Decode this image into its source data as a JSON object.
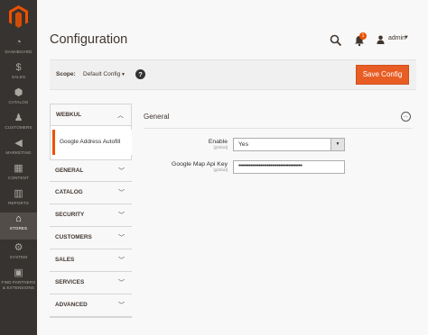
{
  "sidebar": {
    "items": [
      {
        "label": "Dashboard",
        "icon": "speedometer-icon"
      },
      {
        "label": "Sales",
        "icon": "dollar-icon"
      },
      {
        "label": "Catalog",
        "icon": "cube-icon"
      },
      {
        "label": "Customers",
        "icon": "person-icon"
      },
      {
        "label": "Marketing",
        "icon": "megaphone-icon"
      },
      {
        "label": "Content",
        "icon": "layout-icon"
      },
      {
        "label": "Reports",
        "icon": "bar-chart-icon"
      },
      {
        "label": "Stores",
        "icon": "storefront-icon"
      },
      {
        "label": "System",
        "icon": "gear-icon"
      },
      {
        "label": "Find Partners",
        "label2": "& Extensions",
        "icon": "partners-icon"
      }
    ],
    "active": "Stores"
  },
  "header": {
    "title": "Configuration",
    "notification_count": "1",
    "username": "admin"
  },
  "scope": {
    "label": "Scope:",
    "value": "Default Config",
    "help": "?",
    "save_label": "Save Config"
  },
  "config_nav": {
    "sections": [
      "WEBKUL",
      "GENERAL",
      "CATALOG",
      "SECURITY",
      "CUSTOMERS",
      "SALES",
      "SERVICES",
      "ADVANCED"
    ],
    "active_sub_item": "Google Address Autofill"
  },
  "content": {
    "group_title": "General",
    "fields": [
      {
        "label": "Enable",
        "scope": "[global]",
        "value": "Yes"
      },
      {
        "label": "Google Map Api Key",
        "scope": "[global]",
        "value": "••••••••••••••••••••••••••••••••••••••"
      }
    ]
  },
  "colors": {
    "sidebar_bg": "#373330",
    "accent": "#eb5202",
    "save_button": "#e85d24"
  }
}
